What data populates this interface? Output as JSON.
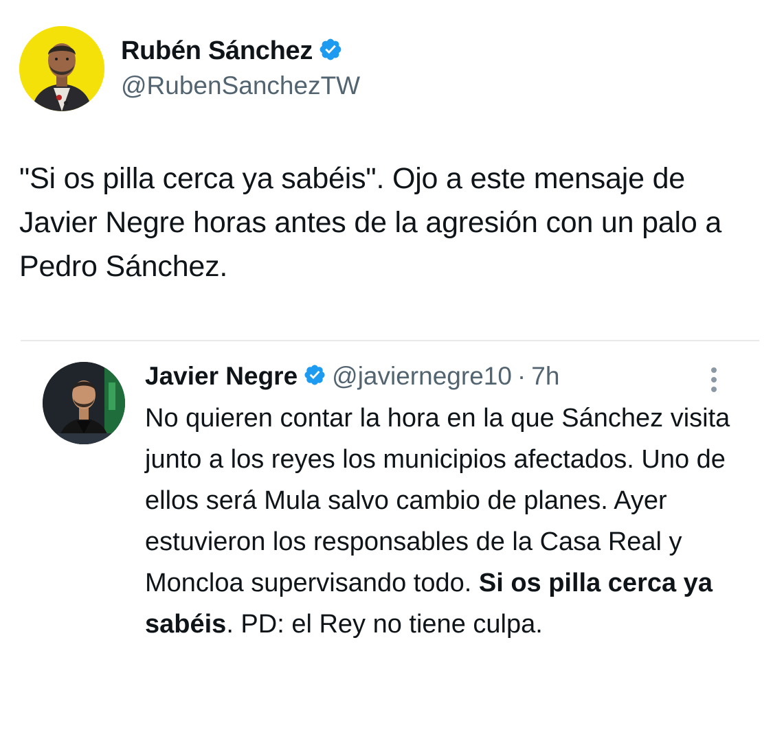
{
  "author": {
    "name": "Rubén Sánchez",
    "handle": "@RubenSanchezTW",
    "verified": true,
    "avatar_bg": "#f5e10a"
  },
  "tweet": {
    "text": "\"Si os pilla cerca ya sabéis\". Ojo a este mensaje de Javier Negre horas antes de la agresión con un palo a Pedro Sánchez."
  },
  "quoted_tweet": {
    "name": "Javier Negre",
    "handle": "@javiernegre10",
    "separator": "·",
    "time": "7h",
    "verified": true,
    "text_before": "No quieren contar la hora en la que Sánchez visita junto a los reyes los municipios afectados. Uno de ellos será Mula salvo cambio de planes. Ayer estuvieron los responsables de la Casa Real y Moncloa supervisando todo. ",
    "text_bold": "Si os pilla cerca ya sabéis",
    "text_after": ". PD: el Rey no tiene culpa."
  },
  "icons": {
    "verified": "verified-badge-icon",
    "more": "more-options-icon"
  },
  "colors": {
    "verified_blue": "#1d9bf0",
    "text_primary": "#0f1419",
    "text_secondary": "#536471",
    "divider": "#e7e9ea"
  }
}
